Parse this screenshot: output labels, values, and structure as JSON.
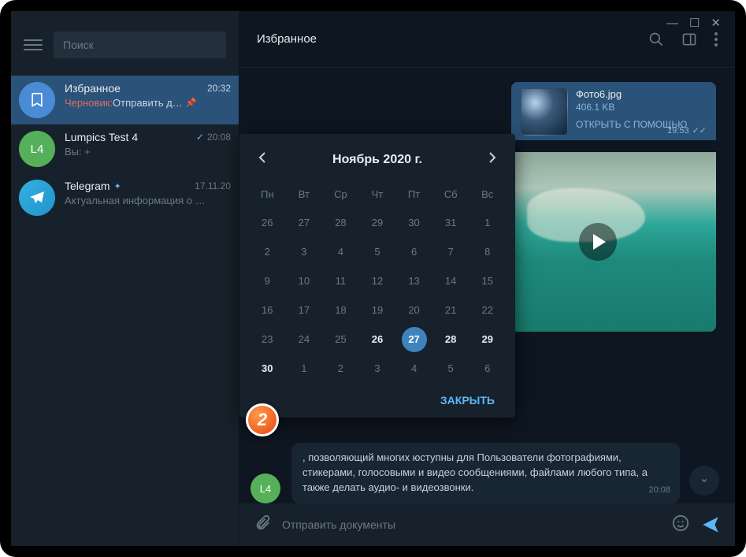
{
  "sidebar": {
    "search_placeholder": "Поиск",
    "chats": [
      {
        "name": "Избранное",
        "time": "20:32",
        "draft_label": "Черновик: ",
        "preview": "Отправить д…"
      },
      {
        "name": "Lumpics Test 4",
        "avatar": "L4",
        "time": "20:08",
        "preview": "Вы: +"
      },
      {
        "name": "Telegram",
        "time": "17.11.20",
        "preview": "Актуальная информация о …"
      }
    ]
  },
  "header": {
    "title": "Избранное"
  },
  "messages": {
    "file": {
      "name": "Фото6.jpg",
      "size": "406.1 KB",
      "open_label": "ОТКРЫТЬ С ПОМОЩЬЮ",
      "time": "19:53"
    },
    "bubble": {
      "avatar": "L4",
      "text": ", позволяющий многих юступны для Пользователи фотографиями, стикерами, голосовыми и видео сообщениями, файлами любого типа, а также делать аудио- и видеозвонки.",
      "time": "20:08"
    }
  },
  "compose": {
    "placeholder": "Отправить документы"
  },
  "calendar": {
    "title": "Ноябрь 2020 г.",
    "close_label": "ЗАКРЫТЬ",
    "weekdays": [
      "Пн",
      "Вт",
      "Ср",
      "Чт",
      "Пт",
      "Сб",
      "Вс"
    ],
    "days": [
      {
        "d": 26
      },
      {
        "d": 27
      },
      {
        "d": 28
      },
      {
        "d": 29
      },
      {
        "d": 30
      },
      {
        "d": 31
      },
      {
        "d": 1
      },
      {
        "d": 2
      },
      {
        "d": 3
      },
      {
        "d": 4
      },
      {
        "d": 5
      },
      {
        "d": 6
      },
      {
        "d": 7
      },
      {
        "d": 8
      },
      {
        "d": 9
      },
      {
        "d": 10
      },
      {
        "d": 11
      },
      {
        "d": 12
      },
      {
        "d": 13
      },
      {
        "d": 14
      },
      {
        "d": 15
      },
      {
        "d": 16
      },
      {
        "d": 17
      },
      {
        "d": 18
      },
      {
        "d": 19
      },
      {
        "d": 20
      },
      {
        "d": 21
      },
      {
        "d": 22
      },
      {
        "d": 23
      },
      {
        "d": 24
      },
      {
        "d": 25
      },
      {
        "d": 26,
        "cur": true
      },
      {
        "d": 27,
        "sel": true
      },
      {
        "d": 28,
        "cur": true
      },
      {
        "d": 29,
        "cur": true
      },
      {
        "d": 30,
        "cur": true
      },
      {
        "d": 1
      },
      {
        "d": 2
      },
      {
        "d": 3
      },
      {
        "d": 4
      },
      {
        "d": 5
      },
      {
        "d": 6
      }
    ]
  },
  "annotation": {
    "step": "2"
  }
}
